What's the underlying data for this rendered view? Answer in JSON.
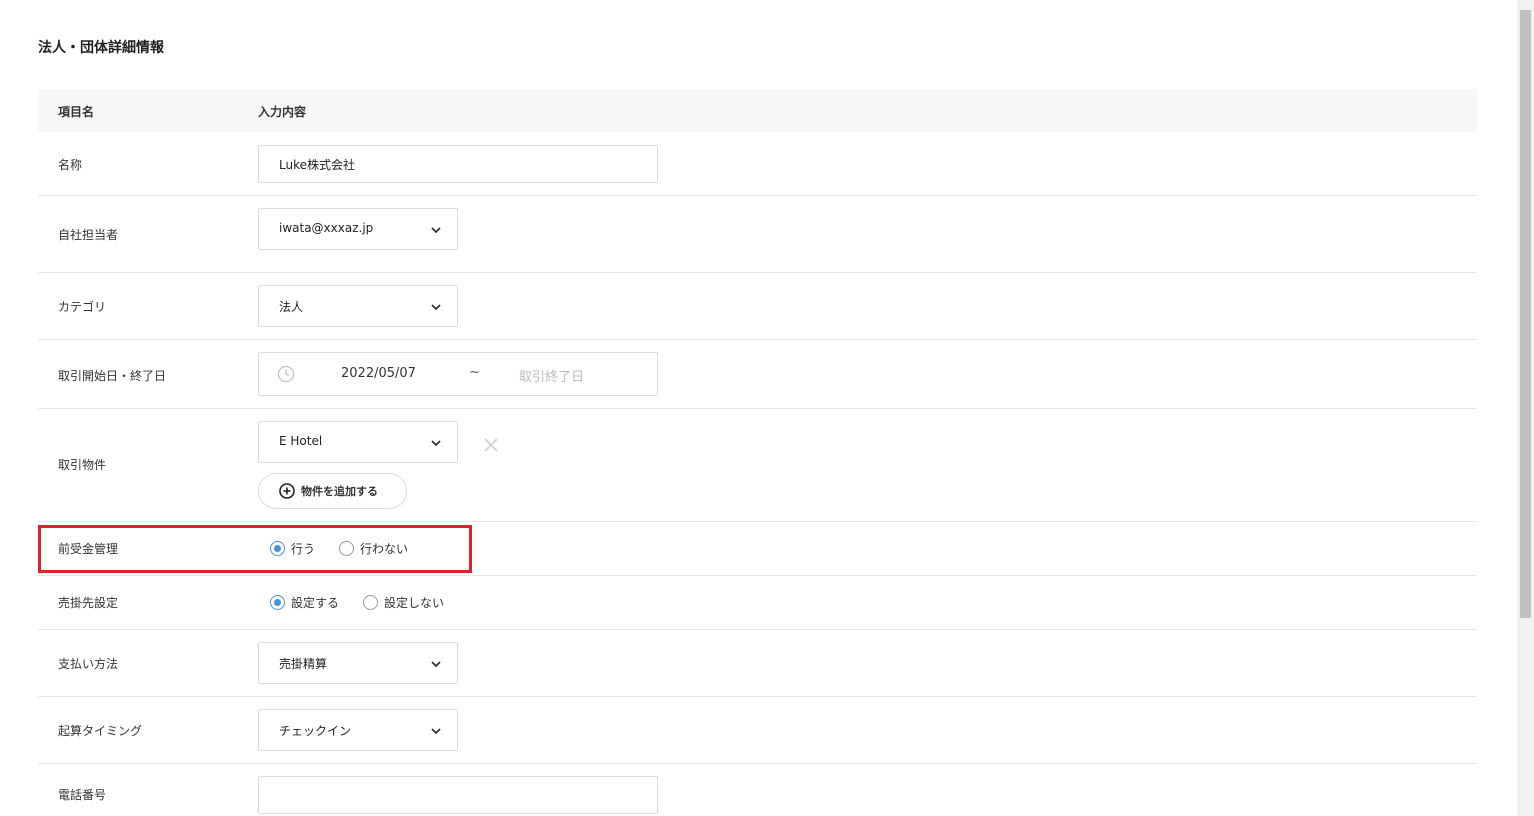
{
  "page_title": "法人・団体詳細情報",
  "table_header": {
    "col_item": "項目名",
    "col_input": "入力内容"
  },
  "fields": {
    "name": {
      "label": "名称",
      "value": "Luke株式会社"
    },
    "owner": {
      "label": "自社担当者",
      "value": "iwata@xxxaz.jp"
    },
    "category": {
      "label": "カテゴリ",
      "value": "法人"
    },
    "period": {
      "label": "取引開始日・終了日",
      "start": "2022/05/07",
      "separator": "~",
      "end_placeholder": "取引終了日"
    },
    "property": {
      "label": "取引物件",
      "value": "E Hotel",
      "add_button": "物件を追加する"
    },
    "prepayment": {
      "label": "前受金管理",
      "options": [
        "行う",
        "行わない"
      ],
      "selected": "行う"
    },
    "receivable": {
      "label": "売掛先設定",
      "options": [
        "設定する",
        "設定しない"
      ],
      "selected": "設定する"
    },
    "payment_method": {
      "label": "支払い方法",
      "value": "売掛精算"
    },
    "timing": {
      "label": "起算タイミング",
      "value": "チェックイン"
    },
    "phone": {
      "label": "電話番号",
      "value": ""
    }
  },
  "colors": {
    "highlight": "#e0202a",
    "radio_accent": "#4a90d9",
    "header_bg": "#f7f7f7"
  }
}
